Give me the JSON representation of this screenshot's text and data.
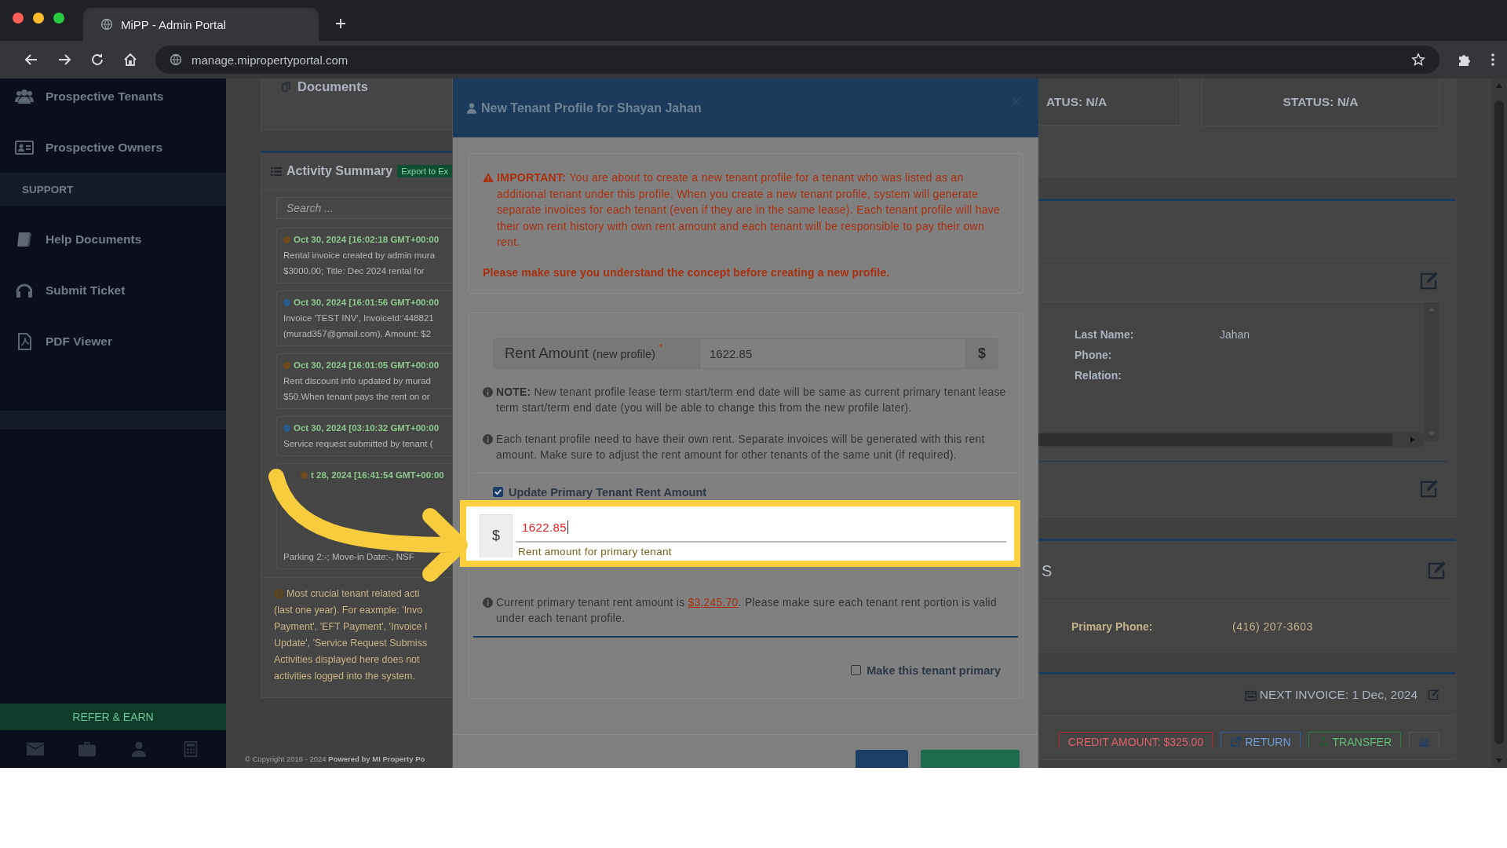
{
  "browser": {
    "tab_title": "MiPP - Admin Portal",
    "url": "manage.mipropertyportal.com"
  },
  "sidebar": {
    "items": [
      {
        "label": "Prospective Tenants",
        "kind": "link"
      },
      {
        "label": "Prospective Owners",
        "kind": "link"
      },
      {
        "label": "SUPPORT",
        "kind": "header"
      },
      {
        "label": "Help Documents",
        "kind": "link"
      },
      {
        "label": "Submit Ticket",
        "kind": "link"
      },
      {
        "label": "PDF Viewer",
        "kind": "link"
      }
    ],
    "refer_button": "REFER & EARN"
  },
  "documents_panel": {
    "title": "Documents"
  },
  "activity": {
    "title": "Activity Summary",
    "export_label": "Export to Ex",
    "search_placeholder": "Search ...",
    "items": [
      {
        "date": "Oct 30, 2024 [16:02:18 GMT+00:00",
        "color": "#6e4a1c",
        "lines": [
          "Rental invoice created by admin mura",
          "$3000.00; Title: Dec 2024 rental for"
        ]
      },
      {
        "date": "Oct 30, 2024 [16:01:56 GMT+00:00",
        "color": "#2c5b8e",
        "lines": [
          "Invoice 'TEST INV', InvoiceId:'448821",
          "(murad357@gmail.com). Amount: $2"
        ]
      },
      {
        "date": "Oct 30, 2024 [16:01:05 GMT+00:00",
        "color": "#6e4a1c",
        "lines": [
          "Rent discount info updated by murad",
          "$50.When tenant pays the rent on or"
        ]
      },
      {
        "date": "Oct 30, 2024 [03:10:32 GMT+00:00",
        "color": "#2c5b8e",
        "lines": [
          "Service request submitted by tenant ("
        ]
      },
      {
        "date": "t 28, 2024 [16:41:54 GMT+00:00",
        "color": "#6e4a1c",
        "lines": [
          "Parking 2:-; Move-in Date:-, NSF"
        ]
      }
    ],
    "note_lines": [
      "Most crucial tenant related acti",
      "(last one year). For eaxmple: 'Invo",
      "Payment', 'EFT Payment', 'Invoice I",
      "Update', 'Service Request Submiss",
      "Activities displayed here does not",
      "activities logged into the system."
    ]
  },
  "footer": {
    "copyright": "© Copyright 2016 - 2024",
    "powered": "Powered by MI Property Po"
  },
  "modal": {
    "title": "New Tenant Profile for Shayan Jahan",
    "warning": "**IMPORTANT:** You are about to create a new tenant profile for a tenant who was listed as an additional tenant under this profile. When you create a new tenant profile, system will generate separate invoices for each tenant (even if they are in the same lease). Each tenant profile will have their own rent history with own rent amount and each tenant will be responsible to pay their own rent.",
    "warning_emphasis": "Please make sure you understand the concept before creating a new profile.",
    "rent_label": "Rent Amount",
    "rent_label_note": "(new profile)",
    "required_mark": "*",
    "rent_value": "1622.85",
    "currency": "$",
    "notes": [
      "**NOTE:** New tenant profile lease term start/term end date will be same as current primary tenant lease term start/term end date (you will be able to change this from the new profile later).",
      "Each tenant profile need to have their own rent. Separate invoices will be generated with this rent amount. Make sure to adjust the rent amount for other tenants of the same unit (if required)."
    ],
    "update_checkbox": {
      "label": "Update Primary Tenant Rent Amount",
      "checked": true
    },
    "primary_rent": {
      "currency": "$",
      "value": "1622.85",
      "hint": "Rent amount for primary tenant"
    },
    "current_note": {
      "before": "Current primary tenant rent amount is ",
      "link": "$3,245.70",
      "after": ". Please make sure each tenant rent portion is valid under each tenant profile."
    },
    "make_primary": {
      "label": "Make this tenant primary",
      "checked": false
    },
    "footer_buttons": [
      {
        "kind": "primary"
      },
      {
        "kind": "success"
      }
    ]
  },
  "right": {
    "status_cards": [
      "ATUS: N/A",
      "STATUS: N/A"
    ],
    "details": [
      {
        "label": "Last Name:",
        "value": "Jahan"
      },
      {
        "label": "Phone:"
      },
      {
        "label": "Relation:"
      }
    ],
    "contact_heading": "S",
    "contact": [
      {
        "label": "Primary Phone:",
        "value": "(416) 207-3603"
      }
    ],
    "next_invoice": "NEXT INVOICE: 1 Dec, 2024",
    "actions": [
      {
        "kind": "credit",
        "label": "CREDIT AMOUNT: $325.00"
      },
      {
        "kind": "return",
        "label": "RETURN"
      },
      {
        "kind": "transfer",
        "label": "TRANSFER"
      },
      {
        "kind": "chart"
      }
    ]
  }
}
